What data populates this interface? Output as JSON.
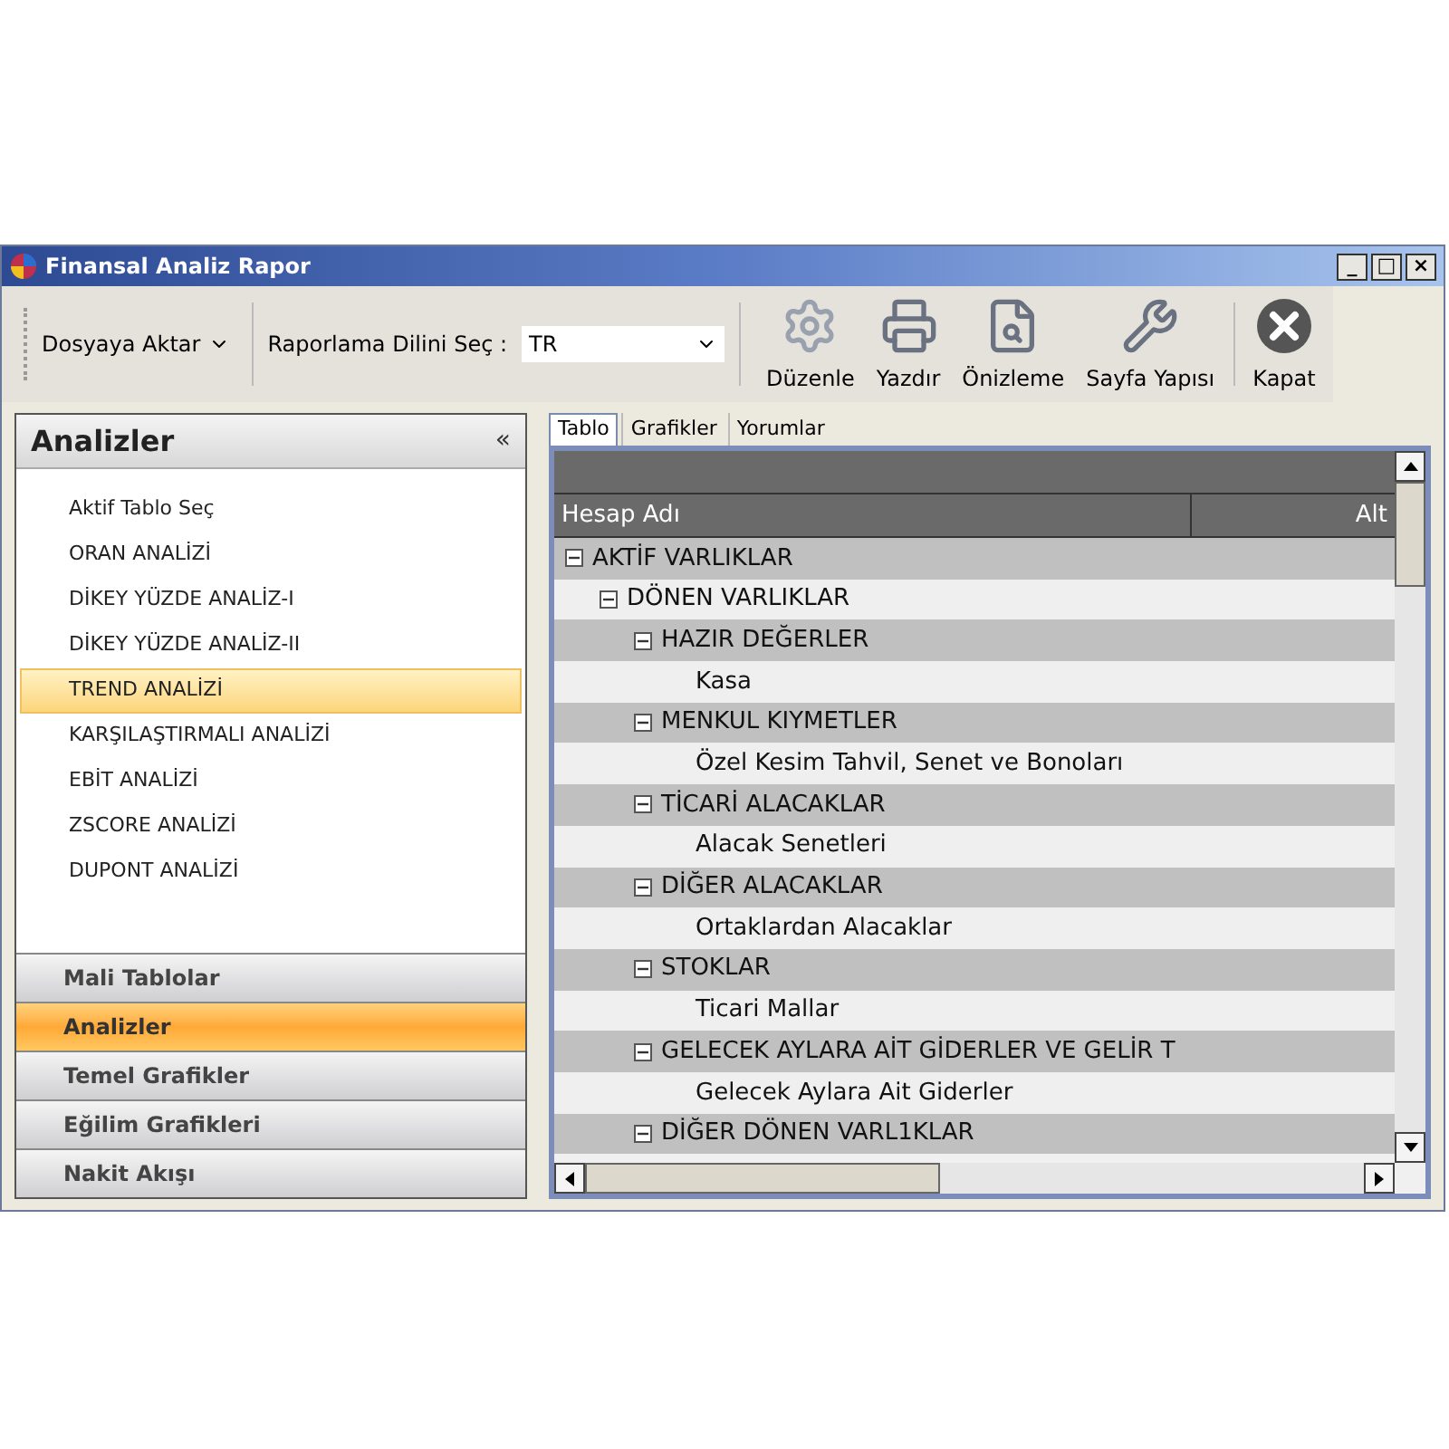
{
  "window": {
    "title": "Finansal Analiz Rapor",
    "controls": [
      "_",
      "□",
      "×"
    ]
  },
  "toolbar": {
    "export_menu": {
      "label": "Dosyaya Aktar"
    },
    "language": {
      "label": "Raporlama Dilini Seç :",
      "value": "TR"
    },
    "buttons": [
      {
        "kind": "settings",
        "label": "Düzenle"
      },
      {
        "kind": "print",
        "label": "Yazdır"
      },
      {
        "kind": "preview",
        "label": "Önizleme"
      },
      {
        "kind": "page-setup",
        "label": "Sayfa Yapısı"
      },
      {
        "kind": "close",
        "label": "Kapat"
      }
    ]
  },
  "sidebar": {
    "title": "Analizler",
    "collapse": "«",
    "items": [
      {
        "label": "Aktif Tablo Seç",
        "selected": false
      },
      {
        "label": "ORAN ANALİZİ",
        "selected": false
      },
      {
        "label": "DİKEY YÜZDE ANALİZ-I",
        "selected": false
      },
      {
        "label": "DİKEY YÜZDE ANALİZ-II",
        "selected": false
      },
      {
        "label": "TREND ANALİZİ",
        "selected": true
      },
      {
        "label": "KARŞILAŞTIRMALI ANALİZİ",
        "selected": false
      },
      {
        "label": "EBİT ANALİZİ",
        "selected": false
      },
      {
        "label": "ZSCORE ANALİZİ",
        "selected": false
      },
      {
        "label": "DUPONT ANALİZİ",
        "selected": false
      }
    ],
    "sections": [
      {
        "label": "Mali Tablolar",
        "selected": false
      },
      {
        "label": "Analizler",
        "selected": true
      },
      {
        "label": "Temel Grafikler",
        "selected": false
      },
      {
        "label": "Eğilim Grafikleri",
        "selected": false
      },
      {
        "label": "Nakit Akışı",
        "selected": false
      }
    ]
  },
  "tabs": [
    {
      "label": "Tablo",
      "selected": true
    },
    {
      "label": "Grafikler",
      "selected": false
    },
    {
      "label": "Yorumlar",
      "selected": false
    }
  ],
  "table": {
    "columns": [
      "Hesap Adı",
      "Alt"
    ],
    "rows": [
      {
        "label": "AKTİF VARLIKLAR",
        "expanded": true,
        "children": [
          {
            "label": "DÖNEN VARLIKLAR",
            "expanded": true,
            "children": [
              {
                "label": "HAZIR DEĞERLER",
                "expanded": true,
                "children": [
                  {
                    "label": "Kasa"
                  }
                ]
              },
              {
                "label": "MENKUL KIYMETLER",
                "expanded": true,
                "children": [
                  {
                    "label": "Özel Kesim Tahvil, Senet ve Bonoları"
                  }
                ]
              },
              {
                "label": "TİCARİ ALACAKLAR",
                "expanded": true,
                "children": [
                  {
                    "label": "Alacak Senetleri"
                  }
                ]
              },
              {
                "label": "DİĞER ALACAKLAR",
                "expanded": true,
                "children": [
                  {
                    "label": "Ortaklardan Alacaklar"
                  }
                ]
              },
              {
                "label": "STOKLAR",
                "expanded": true,
                "children": [
                  {
                    "label": "Ticari Mallar"
                  }
                ]
              },
              {
                "label": "GELECEK AYLARA AİT GİDERLER VE GELİR T",
                "expanded": true,
                "children": [
                  {
                    "label": "Gelecek Aylara Ait Giderler"
                  }
                ]
              },
              {
                "label": "DİĞER DÖNEN VARL1KLAR",
                "expanded": true
              }
            ]
          }
        ]
      }
    ]
  }
}
